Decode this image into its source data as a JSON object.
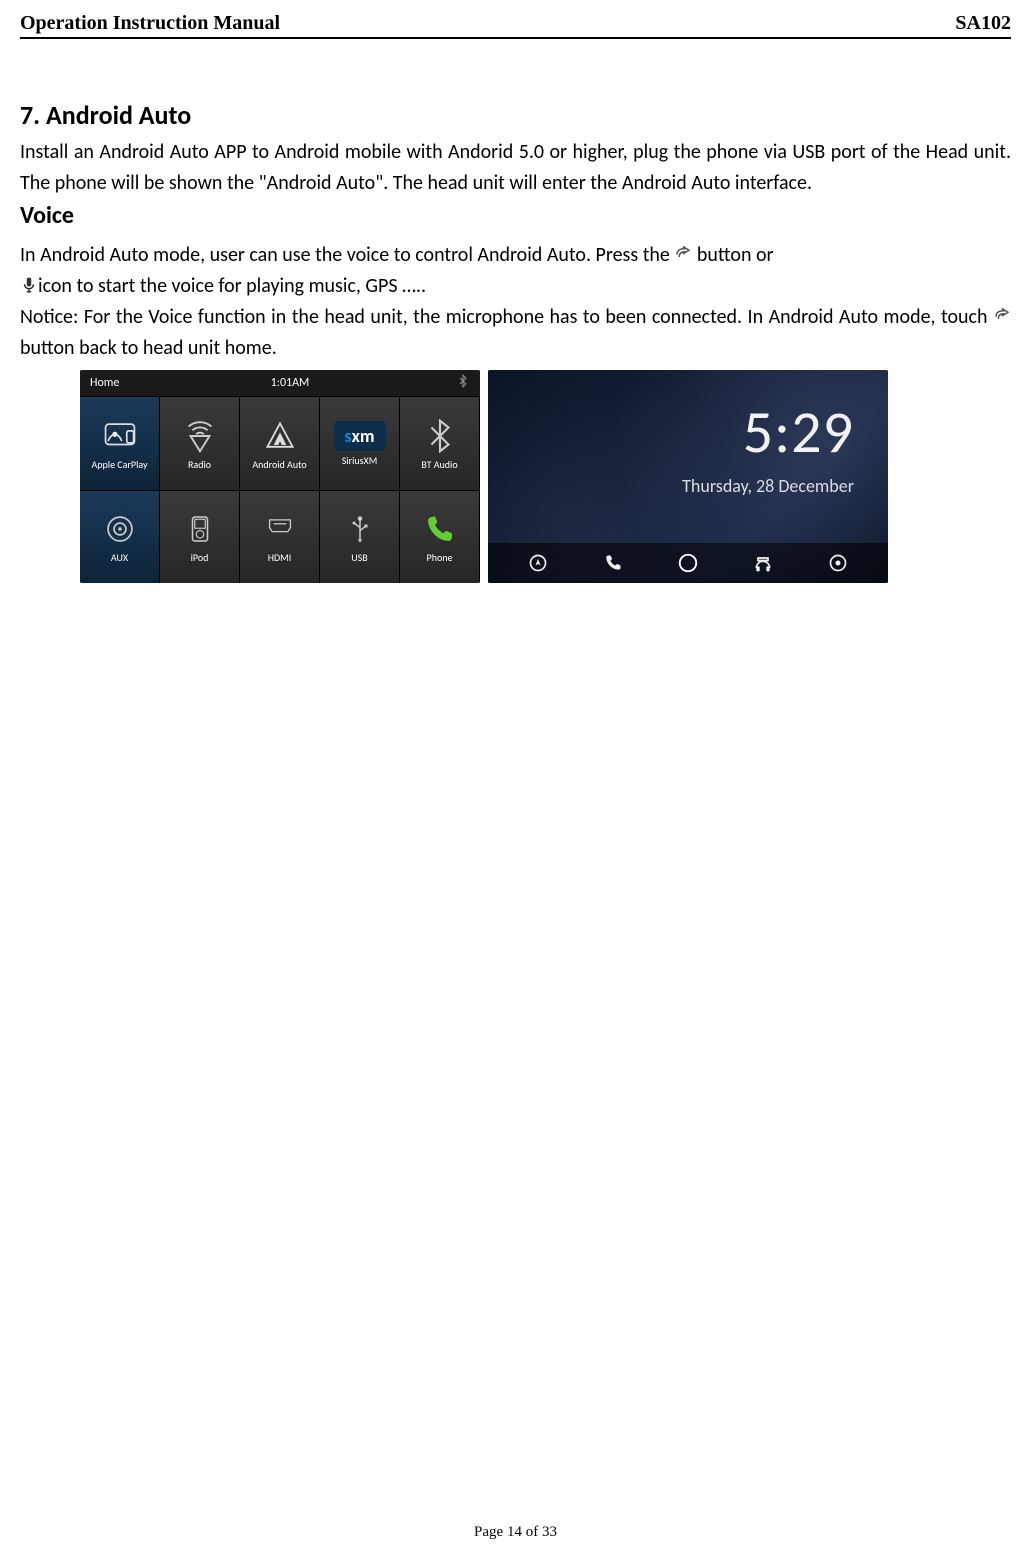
{
  "header": {
    "left": "Operation Instruction Manual",
    "right": "SA102"
  },
  "section": {
    "number": "7.",
    "title": "Android Auto"
  },
  "paragraphs": {
    "intro": "Install an Android Auto APP to Android mobile with Andorid 5.0 or higher, plug the phone via USB port of the Head unit. The phone will be shown the \"Android Auto\". The head unit will enter the Android Auto interface.",
    "voice_heading": "Voice",
    "voice_p1_a": "In Android Auto mode, user can use the voice to control Android Auto. Press the ",
    "voice_p1_b": " button or ",
    "voice_p1_c": "icon to start the voice for playing music, GPS …..",
    "notice_a": "Notice: For the Voice function in the head unit, the microphone has to been connected. In Android Auto mode, touch ",
    "notice_b": " button back to head unit home."
  },
  "headunit": {
    "status": {
      "home": "Home",
      "clock": "1:01AM"
    },
    "cells": [
      {
        "label": "Apple CarPlay"
      },
      {
        "label": "Radio"
      },
      {
        "label": "Android Auto"
      },
      {
        "label": "SiriusXM",
        "brand": "sxm"
      },
      {
        "label": "BT Audio"
      },
      {
        "label": "AUX"
      },
      {
        "label": "iPod"
      },
      {
        "label": "HDMI"
      },
      {
        "label": "USB"
      },
      {
        "label": "Phone"
      }
    ]
  },
  "androidauto": {
    "time": "5:29",
    "date": "Thursday, 28 December"
  },
  "footer": {
    "page": "Page 14 of 33"
  }
}
